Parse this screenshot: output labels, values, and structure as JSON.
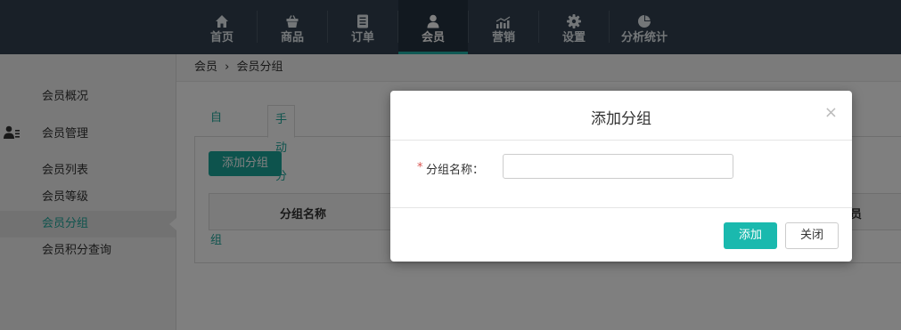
{
  "nav": {
    "items": [
      {
        "label": "首页",
        "icon": "home-icon"
      },
      {
        "label": "商品",
        "icon": "basket-icon"
      },
      {
        "label": "订单",
        "icon": "document-icon"
      },
      {
        "label": "会员",
        "icon": "user-icon"
      },
      {
        "label": "营销",
        "icon": "trend-chart-icon"
      },
      {
        "label": "设置",
        "icon": "gear-icon"
      },
      {
        "label": "分析统计",
        "icon": "pie-chart-icon"
      }
    ],
    "active_index": 3
  },
  "sidebar": {
    "items": [
      {
        "label": "会员概况"
      },
      {
        "label": "会员管理",
        "icon": "users-icon"
      },
      {
        "label": "会员列表"
      },
      {
        "label": "会员等级"
      },
      {
        "label": "会员分组"
      },
      {
        "label": "会员积分查询"
      }
    ],
    "active_index": 4
  },
  "breadcrumb": {
    "items": [
      "会员",
      "会员分组"
    ],
    "separator": "›"
  },
  "tabs": [
    {
      "label": "自动分组"
    },
    {
      "label": "手动分组"
    }
  ],
  "main": {
    "add_button": "添加分组",
    "table_headers": [
      "分组名称",
      "员"
    ]
  },
  "modal": {
    "title": "添加分组",
    "close_symbol": "×",
    "field_required": "*",
    "field_label": "分组名称：",
    "field_value": "",
    "field_placeholder": "",
    "confirm_button": "添加",
    "close_button": "关闭"
  },
  "colors": {
    "accent": "#1ab9ae",
    "topbar": "#324150",
    "required": "#d9534f"
  }
}
